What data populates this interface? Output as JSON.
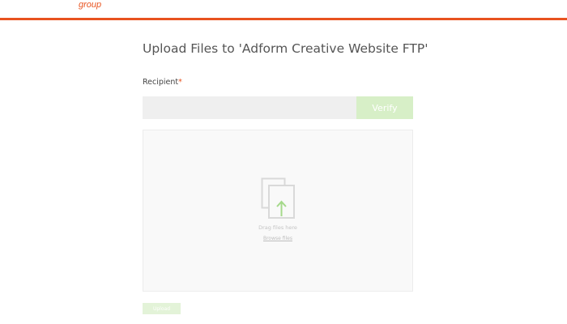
{
  "header": {
    "logo_text": "group",
    "accent_color": "#e8531f"
  },
  "main": {
    "title": "Upload Files to 'Adform Creative Website FTP'",
    "recipient": {
      "label": "Recipient",
      "required_marker": "*",
      "value": "",
      "verify_label": "Verify"
    },
    "dropzone": {
      "icon": "upload-files-icon",
      "hint": "Drag files here",
      "browse_label": "Browse files"
    },
    "upload_label": "Upload"
  },
  "colors": {
    "accent": "#e8531f",
    "button_green": "#d7efc7",
    "arrow_green": "#a5d98b"
  }
}
